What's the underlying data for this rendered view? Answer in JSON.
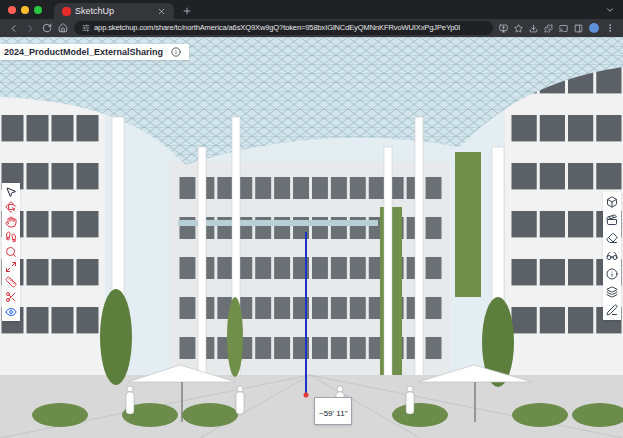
{
  "browser": {
    "tab": {
      "title": "SketchUp",
      "selected": true
    },
    "url": "app.sketchup.com/share/tc/northAmerica/a6sXQ9Xw9gQ?token=958bxIGlNCdEyQMNnKFRvoWUIXxPgJPeYp0I"
  },
  "model": {
    "title": "2024_ProductModel_ExternalSharing"
  },
  "measurement": {
    "label": "~59' 11\""
  }
}
